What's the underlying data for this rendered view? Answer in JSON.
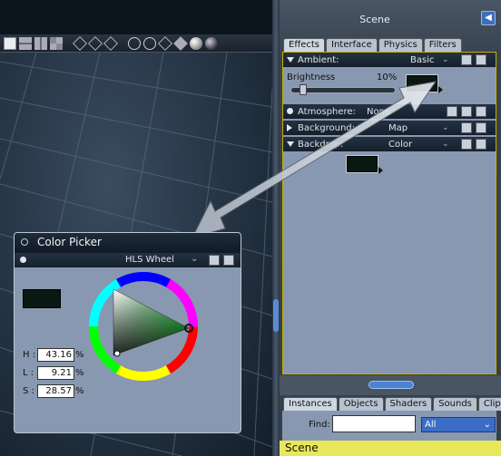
{
  "scene_panel": {
    "title": "Scene",
    "top_tabs": [
      "Effects",
      "Interface",
      "Physics",
      "Filters"
    ],
    "ambient": {
      "label": "Ambient:",
      "value": "Basic",
      "brightness_label": "Brightness",
      "brightness_value": "10%"
    },
    "atmosphere": {
      "label": "Atmosphere:",
      "value": "None"
    },
    "background": {
      "label": "Background:",
      "value": "Map"
    },
    "backdrop": {
      "label": "Backdrop:",
      "value": "Color"
    },
    "bottom_tabs": [
      "Instances",
      "Objects",
      "Shaders",
      "Sounds",
      "Clips"
    ],
    "find_label": "Find:",
    "find_value": "",
    "filter_select": "All",
    "footer": "Scene"
  },
  "color_picker": {
    "title": "Color Picker",
    "mode": "HLS Wheel",
    "h_label": "H :",
    "h_value": "43.16",
    "l_label": "L :",
    "l_value": "9.21",
    "s_label": "S :",
    "s_value": "28.57",
    "pct": "%",
    "swatch_color": "#0b1711"
  }
}
